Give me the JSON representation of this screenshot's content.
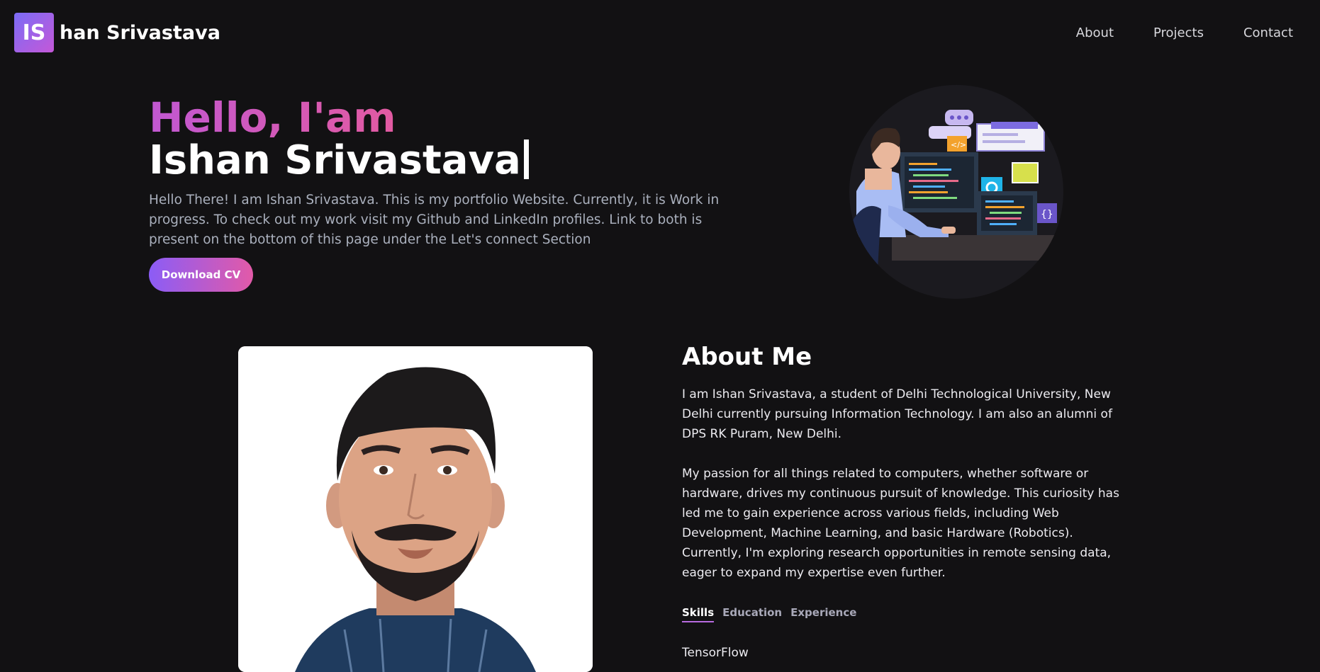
{
  "nav": {
    "logo_initials": "IS",
    "logo_text": "han Srivastava",
    "links": [
      "About",
      "Projects",
      "Contact"
    ]
  },
  "hero": {
    "greeting": "Hello, I'am",
    "name": "Ishan Srivastava",
    "description": "Hello There! I am Ishan Srivastava. This is my portfolio Website. Currently, it is Work in progress. To check out my work visit my Github and LinkedIn profiles. Link to both is present on the bottom of this page under the Let's connect Section",
    "button_label": "Download CV",
    "illustration_icon": "developer-at-computer-illustration"
  },
  "about": {
    "title": "About Me",
    "paragraph1": "I am Ishan Srivastava, a student of Delhi Technological University, New Delhi currently pursuing Information Technology. I am also an alumni of DPS RK Puram, New Delhi.",
    "paragraph2": "My passion for all things related to computers, whether software or hardware, drives my continuous pursuit of knowledge. This curiosity has led me to gain experience across various fields, including Web Development, Machine Learning, and basic Hardware (Robotics). Currently, I'm exploring research opportunities in remote sensing data, eager to expand my expertise even further.",
    "tabs": [
      "Skills",
      "Education",
      "Experience"
    ],
    "active_tab": "Skills",
    "tab_content_first_line": "TensorFlow"
  },
  "colors": {
    "background": "#121113",
    "accent_gradient_start": "#8b5cf6",
    "accent_gradient_end": "#e25aa8",
    "greeting_color": "#c158d2"
  }
}
